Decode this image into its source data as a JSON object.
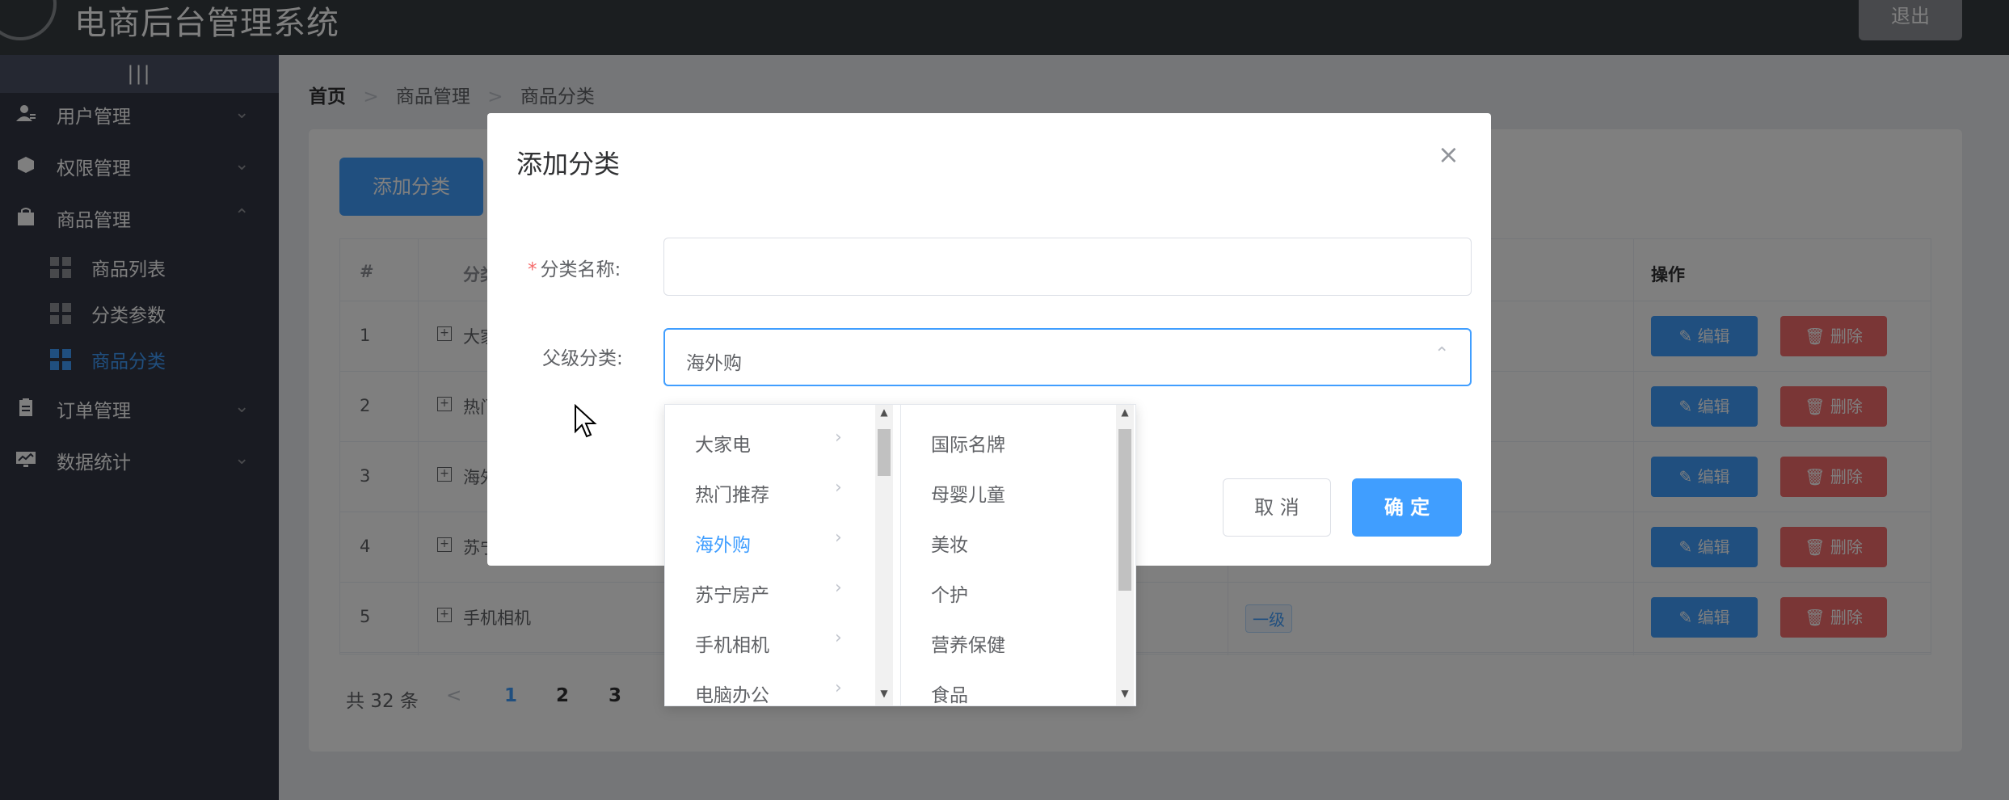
{
  "header": {
    "title": "电商后台管理系统",
    "logout_label": "退出"
  },
  "sidebar": {
    "collapse_label": "|||",
    "menus": [
      {
        "label": "用户管理",
        "icon": "user-icon",
        "expanded": false
      },
      {
        "label": "权限管理",
        "icon": "cube-icon",
        "expanded": false
      },
      {
        "label": "商品管理",
        "icon": "bag-icon",
        "expanded": true
      },
      {
        "label": "订单管理",
        "icon": "clipboard-icon",
        "expanded": false
      },
      {
        "label": "数据统计",
        "icon": "monitor-chart-icon",
        "expanded": false
      }
    ],
    "submenus": [
      {
        "label": "商品列表",
        "active": false
      },
      {
        "label": "分类参数",
        "active": false
      },
      {
        "label": "商品分类",
        "active": true
      }
    ]
  },
  "breadcrumb": {
    "items": [
      "首页",
      "商品管理",
      "商品分类"
    ],
    "separator": ">"
  },
  "main": {
    "add_button": "添加分类",
    "table": {
      "headers": {
        "index": "#",
        "name": "分类名称",
        "operation": "操作"
      },
      "rows": [
        {
          "index": "1",
          "name": "大家电"
        },
        {
          "index": "2",
          "name": "热门推荐"
        },
        {
          "index": "3",
          "name": "海外购"
        },
        {
          "index": "4",
          "name": "苏宁房产"
        },
        {
          "index": "5",
          "name": "手机相机",
          "level": "一级"
        }
      ],
      "edit_label": "编辑",
      "delete_label": "删除",
      "expand_symbol": "+"
    },
    "pagination": {
      "total": "共 32 条",
      "prev": "<",
      "pages": [
        "1",
        "2",
        "3"
      ],
      "current": "1"
    }
  },
  "dialog": {
    "title": "添加分类",
    "close": "×",
    "name_label": "分类名称:",
    "required_mark": "*",
    "name_value": "",
    "parent_label": "父级分类:",
    "parent_value": "海外购",
    "cancel_label": "取 消",
    "ok_label": "确 定"
  },
  "cascader": {
    "level1": [
      "大家电",
      "热门推荐",
      "海外购",
      "苏宁房产",
      "手机相机",
      "电脑办公"
    ],
    "level1_active": "海外购",
    "level2": [
      "国际名牌",
      "母婴儿童",
      "美妆",
      "个护",
      "营养保健",
      "食品"
    ],
    "scroll_up": "▲",
    "scroll_down": "▼"
  },
  "colors": {
    "primary": "#409eff",
    "danger": "#f56c6c",
    "header_bg": "#373d41",
    "sidebar_bg": "#333744"
  }
}
